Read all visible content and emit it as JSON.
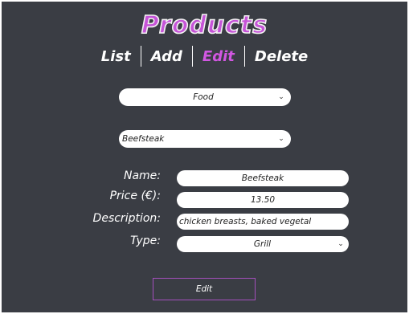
{
  "header": {
    "title": "Products"
  },
  "nav": {
    "items": [
      {
        "label": "List"
      },
      {
        "label": "Add"
      },
      {
        "label": "Edit"
      },
      {
        "label": "Delete"
      }
    ],
    "active": "Edit"
  },
  "category_select": {
    "value": "Food"
  },
  "product_select": {
    "value": "Beefsteak"
  },
  "form": {
    "name": {
      "label": "Name:",
      "value": "Beefsteak"
    },
    "price": {
      "label": "Price (€):",
      "value": "13.50"
    },
    "description": {
      "label": "Description:",
      "value": "chicken breasts, baked vegetal"
    },
    "type": {
      "label": "Type:",
      "value": "Grill"
    }
  },
  "submit": {
    "label": "Edit"
  },
  "colors": {
    "accent": "#d257e2",
    "background": "#3a3d44",
    "title_fill": "#c654d8"
  }
}
